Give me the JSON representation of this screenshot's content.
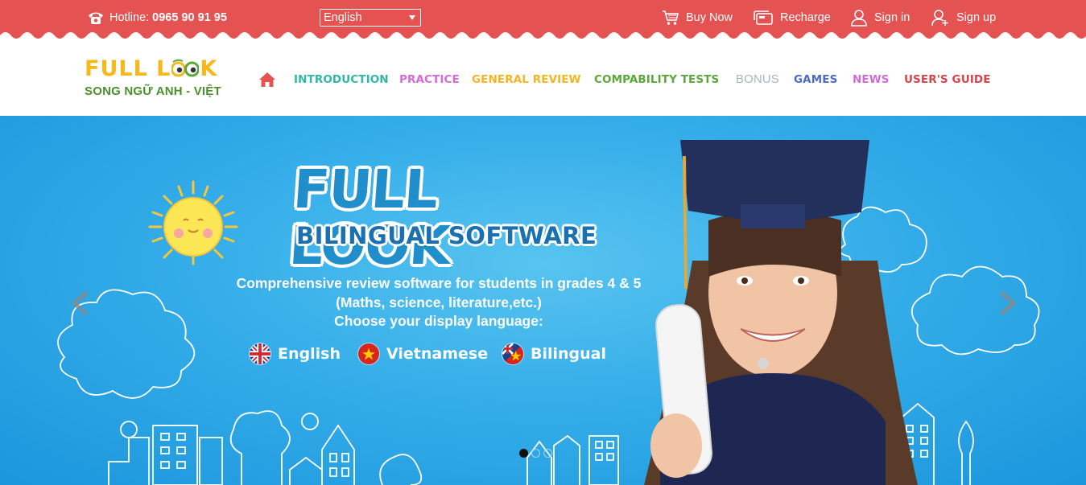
{
  "topbar": {
    "bg_color": "#e45352",
    "hotline_label": "Hotline:",
    "hotline_number": "0965 90 91 95",
    "language_value": "English",
    "buy_now": "Buy Now",
    "recharge": "Recharge",
    "sign_in": "Sign in",
    "sign_up": "Sign up"
  },
  "logo": {
    "title_part1": "FULL L",
    "title_part2": "K",
    "subtitle": "SONG NGỮ ANH - VIỆT"
  },
  "nav": {
    "home_icon": "home-icon",
    "items": [
      {
        "label": "INTRODUCTION",
        "color": "#2fb7a8"
      },
      {
        "label": "PRACTICE",
        "color": "#d66adb"
      },
      {
        "label": "GENERAL REVIEW",
        "color": "#f4b520"
      },
      {
        "label": "COMPABILITY TESTS",
        "color": "#5ba83a"
      },
      {
        "label": "BONUS",
        "color": "#a9b5bf"
      },
      {
        "label": "GAMES",
        "color": "#4d6bc9"
      },
      {
        "label": "NEWS",
        "color": "#d36bd6"
      },
      {
        "label": "USER'S GUIDE",
        "color": "#d9434a"
      }
    ]
  },
  "hero": {
    "title": "FULL LOOK",
    "subtitle": "BILINGUAL SOFTWARE",
    "desc_line1": "Comprehensive review software for students in grades 4 & 5",
    "desc_line2": "(Maths, science, literature,etc.)",
    "desc_line3": "Choose your display language:",
    "options": {
      "english": "English",
      "vietnamese": "Vietnamese",
      "bilingual": "Bilingual"
    },
    "slide_count": 3,
    "active_slide": 1
  }
}
